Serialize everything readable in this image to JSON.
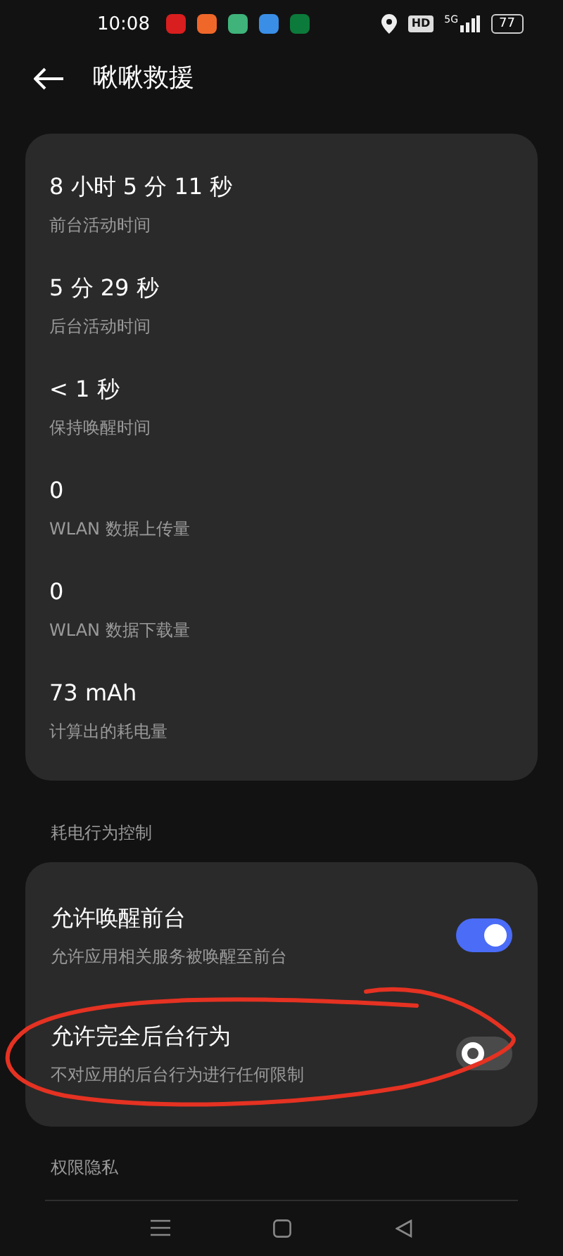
{
  "status_bar": {
    "time": "10:08",
    "hd": "HD",
    "network": "5G",
    "battery": "77"
  },
  "header": {
    "title": "啾啾救援"
  },
  "stats": [
    {
      "value": "8 小时 5 分 11 秒",
      "label": "前台活动时间"
    },
    {
      "value": "5 分 29 秒",
      "label": "后台活动时间"
    },
    {
      "value": "< 1 秒",
      "label": "保持唤醒时间"
    },
    {
      "value": "0",
      "label": "WLAN 数据上传量"
    },
    {
      "value": "0",
      "label": "WLAN 数据下载量"
    },
    {
      "value": "73 mAh",
      "label": "计算出的耗电量"
    }
  ],
  "power_section": {
    "title": "耗电行为控制",
    "items": [
      {
        "title": "允许唤醒前台",
        "subtitle": "允许应用相关服务被唤醒至前台",
        "on": true,
        "circled": false
      },
      {
        "title": "允许完全后台行为",
        "subtitle": "不对应用的后台行为进行任何限制",
        "on": false,
        "circled": true
      }
    ]
  },
  "privacy_section": {
    "title": "权限隐私"
  }
}
